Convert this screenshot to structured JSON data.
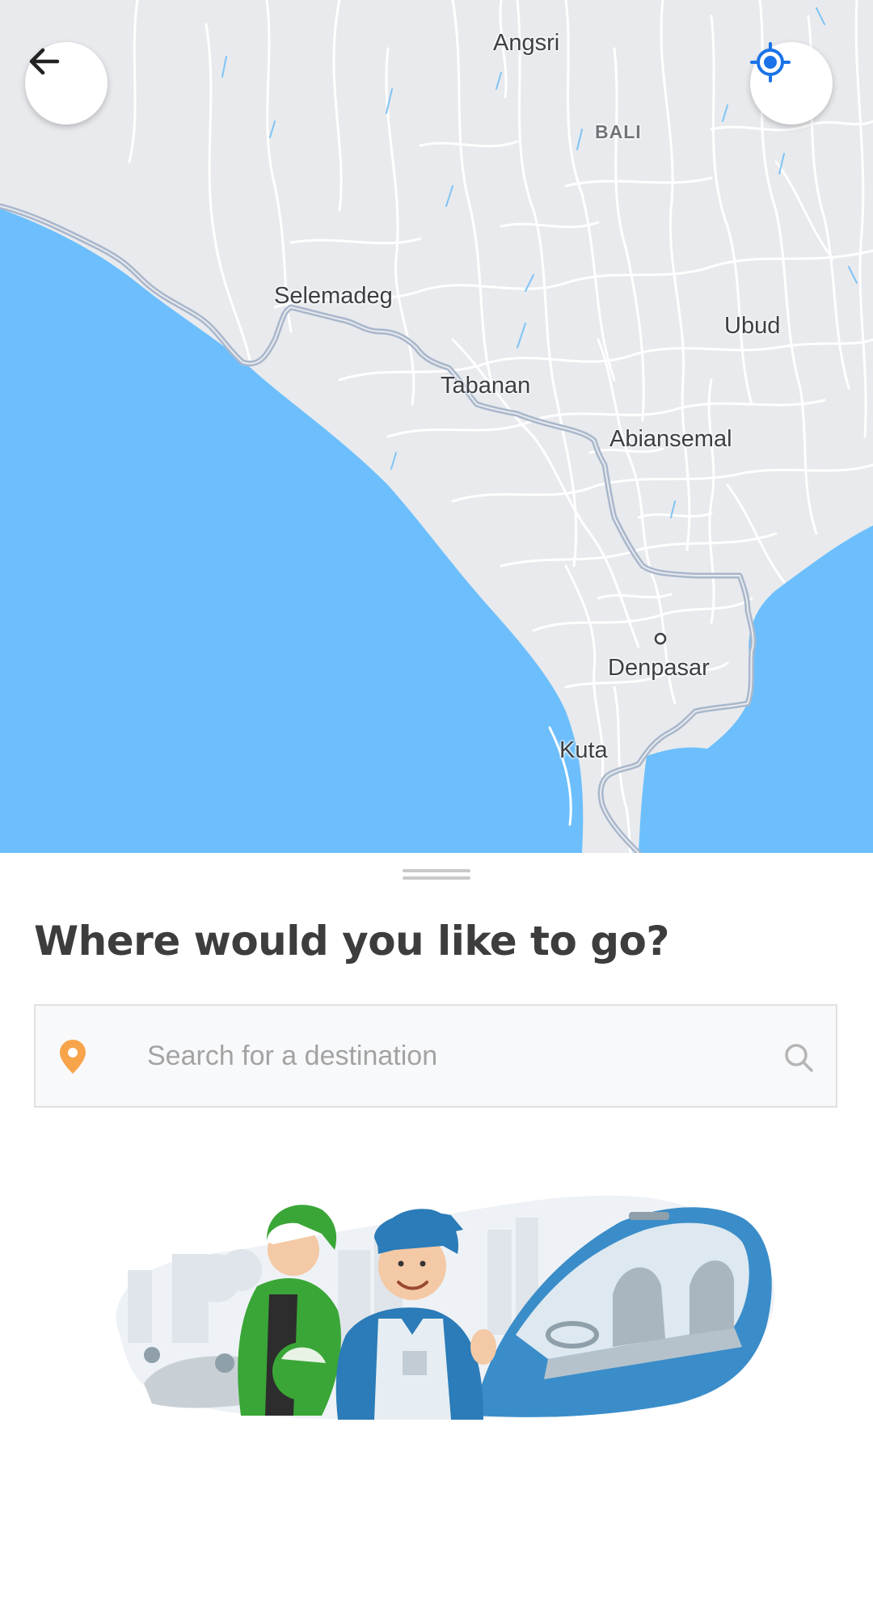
{
  "map": {
    "region_label": "BALI",
    "places": {
      "angsri": "Angsri",
      "selemadeg": "Selemadeg",
      "ubud": "Ubud",
      "tabanan": "Tabanan",
      "abiansemal": "Abiansemal",
      "denpasar": "Denpasar",
      "kuta": "Kuta"
    },
    "colors": {
      "land": "#e8eaed",
      "water": "#6cbffc",
      "roads": "#ffffff",
      "highway": "#a9b7cc"
    }
  },
  "buttons": {
    "back_icon": "arrow-left-icon",
    "locate_icon": "my-location-icon",
    "locate_color": "#1a73e8"
  },
  "sheet": {
    "title": "Where would you like to go?",
    "search": {
      "placeholder": "Search for a destination",
      "value": "",
      "pin_icon": "location-pin-icon",
      "pin_color": "#f7a44a",
      "search_icon": "magnifier-icon"
    },
    "illustration": "driver-and-rider-illustration"
  }
}
